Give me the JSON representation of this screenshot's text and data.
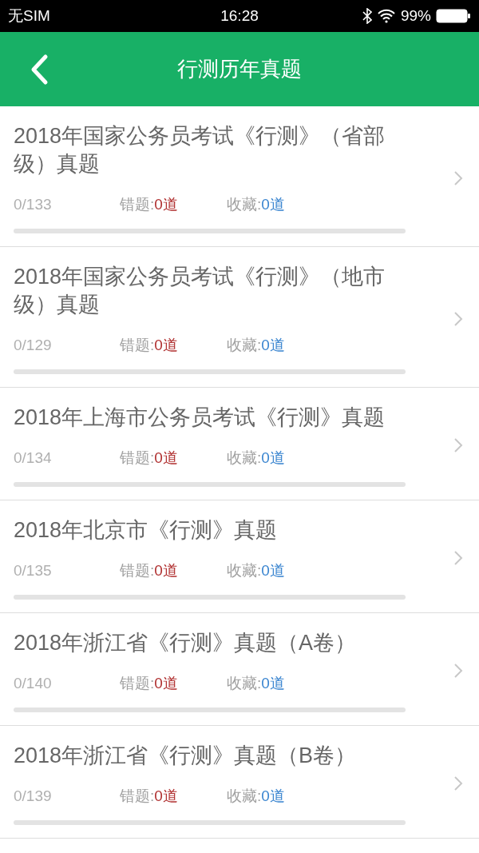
{
  "status_bar": {
    "carrier": "无SIM",
    "time": "16:28",
    "battery": "99%"
  },
  "header": {
    "title": "行测历年真题"
  },
  "papers": [
    {
      "title": "2018年国家公务员考试《行测》（省部级）真题",
      "progress_text": "0/133",
      "wrong_label": "错题:",
      "wrong_count": "0道",
      "fav_label": "收藏:",
      "fav_count": "0道"
    },
    {
      "title": "2018年国家公务员考试《行测》（地市级）真题",
      "progress_text": "0/129",
      "wrong_label": "错题:",
      "wrong_count": "0道",
      "fav_label": "收藏:",
      "fav_count": "0道"
    },
    {
      "title": "2018年上海市公务员考试《行测》真题",
      "progress_text": "0/134",
      "wrong_label": "错题:",
      "wrong_count": "0道",
      "fav_label": "收藏:",
      "fav_count": "0道"
    },
    {
      "title": "2018年北京市《行测》真题",
      "progress_text": "0/135",
      "wrong_label": "错题:",
      "wrong_count": "0道",
      "fav_label": "收藏:",
      "fav_count": "0道"
    },
    {
      "title": "2018年浙江省《行测》真题（A卷）",
      "progress_text": "0/140",
      "wrong_label": "错题:",
      "wrong_count": "0道",
      "fav_label": "收藏:",
      "fav_count": "0道"
    },
    {
      "title": "2018年浙江省《行测》真题（B卷）",
      "progress_text": "0/139",
      "wrong_label": "错题:",
      "wrong_count": "0道",
      "fav_label": "收藏:",
      "fav_count": "0道"
    }
  ]
}
